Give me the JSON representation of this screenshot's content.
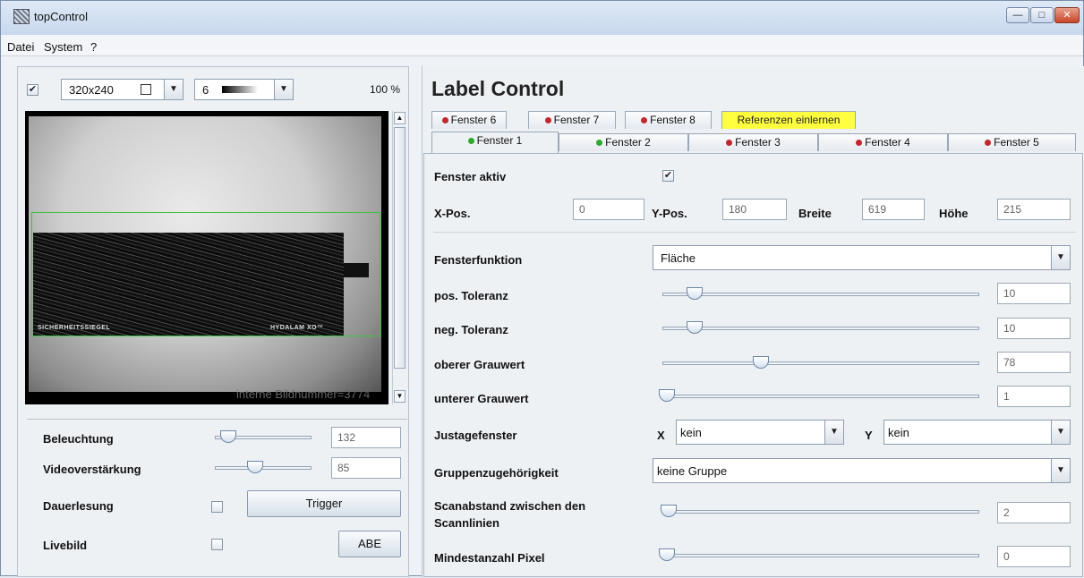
{
  "window": {
    "title": "topControl"
  },
  "menu": [
    "Datei",
    "System",
    "?"
  ],
  "left": {
    "resolution": "320x240",
    "value_combo": "6",
    "zoom": "100 %",
    "image_text_left": "SICHERHEITSSIEGEL",
    "image_text_right": "HYDALAM XO™",
    "frame_number": "interne Bildnummer=3774",
    "controls": {
      "beleuchtung_label": "Beleuchtung",
      "beleuchtung_value": "132",
      "beleuchtung_level": 0.2,
      "video_label": "Videoverstärkung",
      "video_value": "85",
      "video_level": 0.4,
      "dauer_label": "Dauerlesung",
      "trigger_label": "Trigger",
      "livebild_label": "Livebild",
      "abe_label": "ABE"
    }
  },
  "right": {
    "title": "Label Control",
    "tabs_row1": [
      {
        "label": "Fenster 6",
        "status": "red"
      },
      {
        "label": "Fenster 7",
        "status": "red"
      },
      {
        "label": "Fenster 8",
        "status": "red"
      },
      {
        "label": "Referenzen einlernen",
        "status": "none"
      }
    ],
    "tabs_row2": [
      {
        "label": "Fenster 1",
        "status": "green"
      },
      {
        "label": "Fenster 2",
        "status": "green"
      },
      {
        "label": "Fenster 3",
        "status": "red"
      },
      {
        "label": "Fenster 4",
        "status": "red"
      },
      {
        "label": "Fenster 5",
        "status": "red"
      }
    ],
    "fenster_aktiv_label": "Fenster aktiv",
    "xpos_label": "X-Pos.",
    "xpos": "0",
    "ypos_label": "Y-Pos.",
    "ypos": "180",
    "breite_label": "Breite",
    "breite": "619",
    "hoehe_label": "Höhe",
    "hoehe": "215",
    "fensterfunktion_label": "Fensterfunktion",
    "fensterfunktion": "Fläche",
    "pos_tol_label": "pos. Toleranz",
    "pos_tol": "10",
    "pos_tol_level": 0.1,
    "neg_tol_label": "neg. Toleranz",
    "neg_tol": "10",
    "neg_tol_level": 0.1,
    "oberer_label": "oberer Grauwert",
    "oberer": "78",
    "oberer_level": 0.3,
    "unterer_label": "unterer Grauwert",
    "unterer": "1",
    "unterer_level": 0.0,
    "justage_label": "Justagefenster",
    "x_label": "X",
    "justage_x": "kein",
    "y_label": "Y",
    "justage_y": "kein",
    "gruppe_label": "Gruppenzugehörigkeit",
    "gruppe": "keine Gruppe",
    "scan_label_1": "Scanabstand zwischen den",
    "scan_label_2": "Scannlinien",
    "scan": "2",
    "scan_level": 0.0,
    "mindest_label": "Mindestanzahl Pixel",
    "mindest": "0",
    "mindest_level": 0.0
  },
  "colors": {
    "status_red": "#c0282d",
    "status_green": "#2fa82f",
    "ref_tab": "#ffff40",
    "roi": "#3fc43f"
  }
}
